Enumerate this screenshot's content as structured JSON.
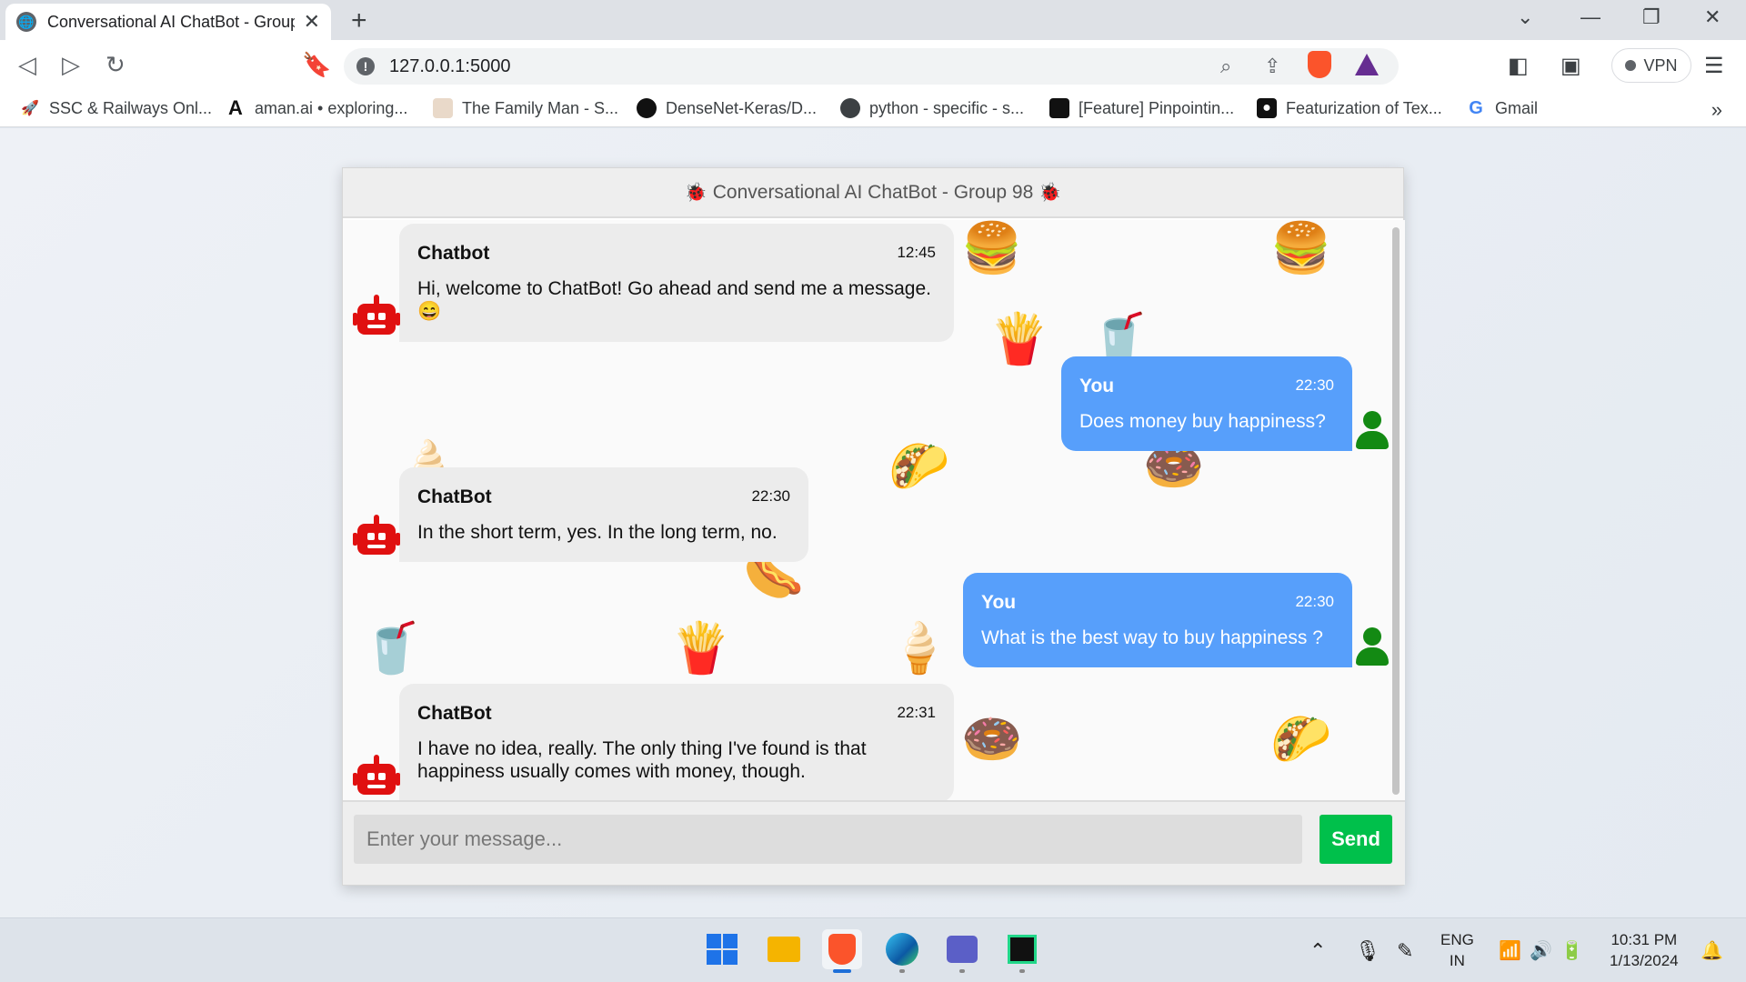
{
  "browser": {
    "tab_title": "Conversational AI ChatBot - Group 98",
    "url": "127.0.0.1:5000",
    "vpn_label": "VPN",
    "bookmarks": [
      {
        "label": "SSC & Railways Onl...",
        "icon": "rocket-icon"
      },
      {
        "label": "aman.ai • exploring...",
        "icon": "aman-logo-icon"
      },
      {
        "label": "The Family Man - S...",
        "icon": "family-man-icon"
      },
      {
        "label": "DenseNet-Keras/D...",
        "icon": "github-icon"
      },
      {
        "label": "python - specific - s...",
        "icon": "globe-icon"
      },
      {
        "label": "[Feature] Pinpointin...",
        "icon": "bar-chart-icon"
      },
      {
        "label": "Featurization of Tex...",
        "icon": "medium-icon"
      },
      {
        "label": "Gmail",
        "icon": "google-icon"
      }
    ]
  },
  "chat": {
    "header_title": "Conversational AI ChatBot - Group 98",
    "input_placeholder": "Enter your message...",
    "send_label": "Send",
    "messages": [
      {
        "side": "left",
        "name": "Chatbot",
        "time": "12:45",
        "text": "Hi, welcome to ChatBot! Go ahead and send me a message. 😄"
      },
      {
        "side": "right",
        "name": "You",
        "time": "22:30",
        "text": "Does money buy happiness?"
      },
      {
        "side": "left",
        "name": "ChatBot",
        "time": "22:30",
        "text": "In the short term, yes. In the long term, no."
      },
      {
        "side": "right",
        "name": "You",
        "time": "22:30",
        "text": "What is the best way to buy happiness ?"
      },
      {
        "side": "left",
        "name": "ChatBot",
        "time": "22:31",
        "text": "I have no idea, really. The only thing I've found is that happiness usually comes with money, though."
      }
    ]
  },
  "taskbar": {
    "lang_line1": "ENG",
    "lang_line2": "IN",
    "time": "10:31 PM",
    "date": "1/13/2024"
  },
  "colors": {
    "user_bubble": "#579ffb",
    "bot_bubble": "#ececec",
    "send_button": "#00c04b",
    "bot_avatar": "#e01010",
    "user_avatar": "#138a13"
  }
}
